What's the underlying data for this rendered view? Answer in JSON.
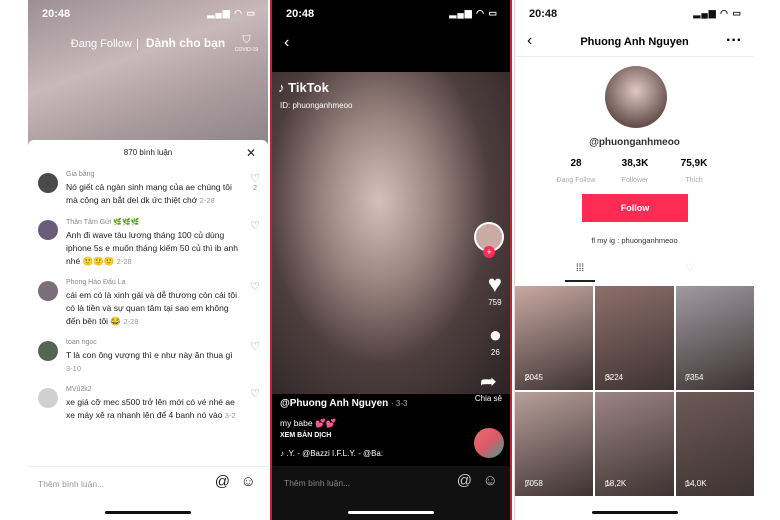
{
  "time": "20:48",
  "left": {
    "tabs": [
      "Đang Follow",
      "Dành cho bạn"
    ],
    "covid": "COVID-19",
    "comment_count": "870 bình luận",
    "comments": [
      {
        "user": "Gia bằng",
        "text": "Nó giết cả ngàn sinh mạng của ae chúng tôi mà công an bắt del dk ức thiệt chớ",
        "date": "2-28",
        "likes": "2"
      },
      {
        "user": "Thân Tâm Gửi 🌿🌿🌿",
        "text": "Anh đi wave tàu lương tháng 100 củ dùng iphone 5s e muốn tháng kiếm 50 củ thì ib anh nhé 🙂🙂🙂",
        "date": "2-28",
        "likes": ""
      },
      {
        "user": "Phong Hào Đấu La",
        "text": "cái em có là xinh gái và dễ thương còn cái tôi có là tiền và sự quan tâm tại sao em không đến bên tôi 😂",
        "date": "2-28",
        "likes": ""
      },
      {
        "user": "toan ngoc",
        "text": "T là con ông vượng thì e như này ăn thua gì",
        "date": "3-10",
        "likes": ""
      },
      {
        "user": "MVũ2k2",
        "text": "xe giá cỡ mec s500 trở lên mới có vé nhé ae xe máy xê ra nhanh lên để 4 banh nó vào",
        "date": "3-2",
        "likes": ""
      }
    ],
    "input_placeholder": "Thêm bình luận..."
  },
  "middle": {
    "logo": "TikTok",
    "id": "ID: phuonganhmeoo",
    "likes": "759",
    "comments": "26",
    "share": "Chia sẻ",
    "author": "@Phuong Anh Nguyen",
    "date": "· 3-3",
    "caption": "my babe 💕💕",
    "translate": "XEM BẢN DỊCH",
    "music": ".Y. - @Bazzi    I.F.L.Y. - @Ba:",
    "input_placeholder": "Thêm bình luận..."
  },
  "right": {
    "title": "Phuong Anh Nguyen",
    "handle": "@phuonganhmeoo",
    "stats": [
      {
        "value": "28",
        "label": "Đang Follow"
      },
      {
        "value": "38,3K",
        "label": "Follower"
      },
      {
        "value": "75,9K",
        "label": "Thích"
      }
    ],
    "follow": "Follow",
    "bio": "fl my ig : phuonganhmeoo",
    "videos": [
      "2045",
      "3224",
      "7354",
      "7058",
      "18,2K",
      "14,0K"
    ]
  },
  "colors": {
    "accent": "#fe2c55"
  }
}
